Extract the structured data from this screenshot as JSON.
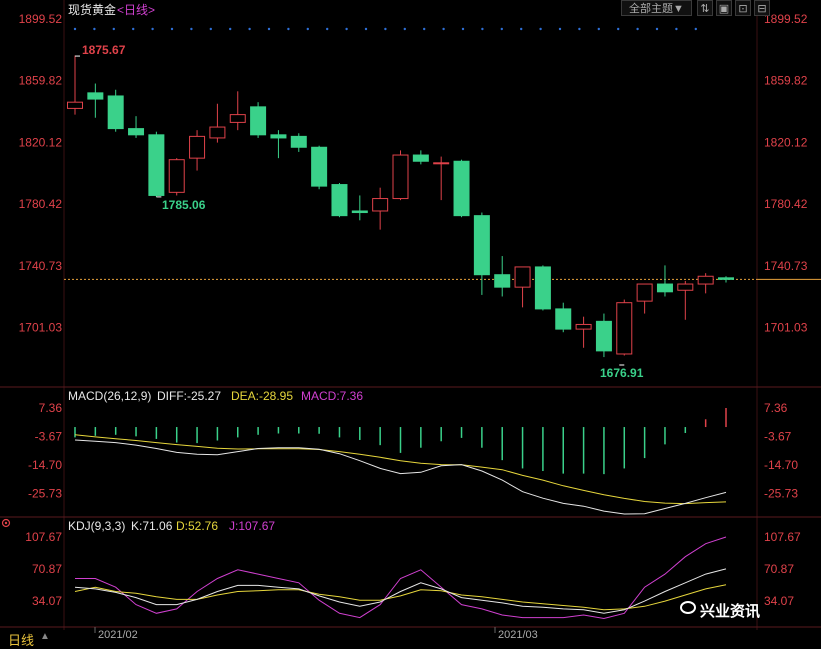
{
  "header": {
    "instrument": "现货黄金",
    "period_tag": "<日线>",
    "theme_dropdown": "全部主题▼",
    "buttons": [
      "⇅",
      "▣",
      "⊡",
      "⊟"
    ]
  },
  "price_axis": {
    "ticks": [
      "1899.52",
      "1859.82",
      "1820.12",
      "1780.42",
      "1740.73",
      "1701.03"
    ],
    "color": "#e0424a"
  },
  "macd_panel": {
    "label": "MACD(26,12,9)",
    "diff": "DIFF:-25.27",
    "dea": "DEA:-28.95",
    "macd": "MACD:7.36",
    "ticks": [
      "7.36",
      "-3.67",
      "-14.70",
      "-25.73"
    ]
  },
  "kdj_panel": {
    "label": "KDJ(9,3,3)",
    "k": "K:71.06",
    "d": "D:52.76",
    "j": "J:107.67",
    "ticks": [
      "107.67",
      "70.87",
      "34.07"
    ]
  },
  "footer": {
    "period_button": "日线",
    "arrow": "▲",
    "date_labels": [
      "2021/02",
      "2021/03"
    ],
    "watermark": "兴业资讯"
  },
  "chart_data": [
    {
      "type": "candlestick",
      "title": "现货黄金",
      "period": "日线",
      "ylim": [
        1676.91,
        1899.52
      ],
      "last_price_line": 1732,
      "high_label": "1875.67",
      "low_labels": [
        "1785.06",
        "1676.91"
      ],
      "candles": [
        {
          "o": 1842,
          "h": 1876,
          "l": 1838,
          "c": 1846
        },
        {
          "o": 1852,
          "h": 1858,
          "l": 1836,
          "c": 1848
        },
        {
          "o": 1850,
          "h": 1854,
          "l": 1827,
          "c": 1829
        },
        {
          "o": 1829,
          "h": 1837,
          "l": 1823,
          "c": 1825
        },
        {
          "o": 1825,
          "h": 1827,
          "l": 1785,
          "c": 1786
        },
        {
          "o": 1788,
          "h": 1810,
          "l": 1786,
          "c": 1809
        },
        {
          "o": 1810,
          "h": 1828,
          "l": 1802,
          "c": 1824
        },
        {
          "o": 1823,
          "h": 1845,
          "l": 1820,
          "c": 1830
        },
        {
          "o": 1833,
          "h": 1853,
          "l": 1828,
          "c": 1838
        },
        {
          "o": 1843,
          "h": 1846,
          "l": 1823,
          "c": 1825
        },
        {
          "o": 1825,
          "h": 1828,
          "l": 1810,
          "c": 1823
        },
        {
          "o": 1824,
          "h": 1826,
          "l": 1814,
          "c": 1817
        },
        {
          "o": 1817,
          "h": 1818,
          "l": 1790,
          "c": 1792
        },
        {
          "o": 1793,
          "h": 1794,
          "l": 1772,
          "c": 1773
        },
        {
          "o": 1776,
          "h": 1786,
          "l": 1770,
          "c": 1775
        },
        {
          "o": 1776,
          "h": 1791,
          "l": 1764,
          "c": 1784
        },
        {
          "o": 1784,
          "h": 1815,
          "l": 1783,
          "c": 1812
        },
        {
          "o": 1812,
          "h": 1815,
          "l": 1806,
          "c": 1808
        },
        {
          "o": 1807,
          "h": 1811,
          "l": 1783,
          "c": 1807
        },
        {
          "o": 1808,
          "h": 1809,
          "l": 1772,
          "c": 1773
        },
        {
          "o": 1773,
          "h": 1775,
          "l": 1722,
          "c": 1735
        },
        {
          "o": 1735,
          "h": 1747,
          "l": 1721,
          "c": 1727
        },
        {
          "o": 1727,
          "h": 1738,
          "l": 1714,
          "c": 1740
        },
        {
          "o": 1740,
          "h": 1741,
          "l": 1712,
          "c": 1713
        },
        {
          "o": 1713,
          "h": 1717,
          "l": 1698,
          "c": 1700
        },
        {
          "o": 1700,
          "h": 1708,
          "l": 1688,
          "c": 1703
        },
        {
          "o": 1705,
          "h": 1710,
          "l": 1682,
          "c": 1686
        },
        {
          "o": 1684,
          "h": 1719,
          "l": 1683,
          "c": 1717
        },
        {
          "o": 1718,
          "h": 1728,
          "l": 1710,
          "c": 1729
        },
        {
          "o": 1729,
          "h": 1741,
          "l": 1721,
          "c": 1724
        },
        {
          "o": 1725,
          "h": 1731,
          "l": 1706,
          "c": 1729
        },
        {
          "o": 1729,
          "h": 1736,
          "l": 1723,
          "c": 1734
        },
        {
          "o": 1733,
          "h": 1734,
          "l": 1730,
          "c": 1732
        }
      ]
    },
    {
      "type": "line",
      "title": "MACD(26,12,9)",
      "ylim": [
        -34,
        7.36
      ],
      "diff": [
        -5,
        -5.5,
        -6,
        -7,
        -8.3,
        -9.8,
        -10.5,
        -10.7,
        -9.5,
        -8.3,
        -8,
        -8,
        -8.6,
        -10.3,
        -13,
        -16,
        -18,
        -17.5,
        -15,
        -14.5,
        -17,
        -20.5,
        -25,
        -27.5,
        -29.5,
        -30.6,
        -32.5,
        -33.6,
        -33.5,
        -31.5,
        -29.5,
        -27.3,
        -25.27
      ],
      "dea": [
        -3,
        -3.8,
        -4.5,
        -5.2,
        -6,
        -6.8,
        -7.5,
        -8.2,
        -8.5,
        -8.4,
        -8.4,
        -8.4,
        -8.7,
        -9.5,
        -10.5,
        -11.7,
        -13,
        -14,
        -14.5,
        -14.6,
        -15.5,
        -16.5,
        -18.7,
        -20.5,
        -22.7,
        -24.5,
        -26.2,
        -27.6,
        -28.8,
        -29.4,
        -29.6,
        -29.2,
        -28.95
      ],
      "histogram": [
        -4,
        -3.4,
        -3,
        -3.6,
        -4.6,
        -6,
        -6.2,
        -5.2,
        -4,
        -3,
        -2.5,
        -2.5,
        -2.6,
        -4,
        -5,
        -7,
        -10,
        -8,
        -5.5,
        -4.2,
        -8,
        -12.8,
        -16,
        -17,
        -18,
        -18,
        -18.2,
        -16,
        -12,
        -6.7,
        -2.3,
        3,
        7.36
      ],
      "series": [
        {
          "name": "DIFF",
          "color": "#e6e6e6"
        },
        {
          "name": "DEA",
          "color": "#e6d63c"
        },
        {
          "name": "MACD",
          "color": "#d040d0"
        }
      ]
    },
    {
      "type": "line",
      "title": "KDJ(9,3,3)",
      "ylim": [
        10,
        107.67
      ],
      "k": [
        50,
        48,
        44,
        38,
        30,
        30,
        36,
        45,
        52,
        52,
        50,
        48,
        40,
        33,
        28,
        33,
        45,
        55,
        48,
        38,
        35,
        32,
        28,
        27,
        25,
        24,
        20,
        24,
        34,
        45,
        55,
        65,
        71.06
      ],
      "d": [
        45,
        50,
        45,
        43,
        39,
        36,
        36,
        41,
        45,
        46,
        47,
        47,
        42,
        39,
        35,
        35,
        40,
        47,
        46,
        41,
        39,
        36,
        33,
        31,
        29,
        27,
        24,
        25,
        28,
        34,
        41,
        48,
        52.76
      ],
      "j": [
        60,
        60,
        50,
        30,
        20,
        25,
        45,
        60,
        70,
        65,
        60,
        55,
        35,
        20,
        15,
        30,
        60,
        70,
        50,
        30,
        25,
        18,
        15,
        15,
        15,
        18,
        14,
        20,
        50,
        65,
        85,
        100,
        107.67
      ],
      "series": [
        {
          "name": "K",
          "color": "#e6e6e6"
        },
        {
          "name": "D",
          "color": "#e6d63c"
        },
        {
          "name": "J",
          "color": "#d040d0"
        }
      ]
    }
  ]
}
